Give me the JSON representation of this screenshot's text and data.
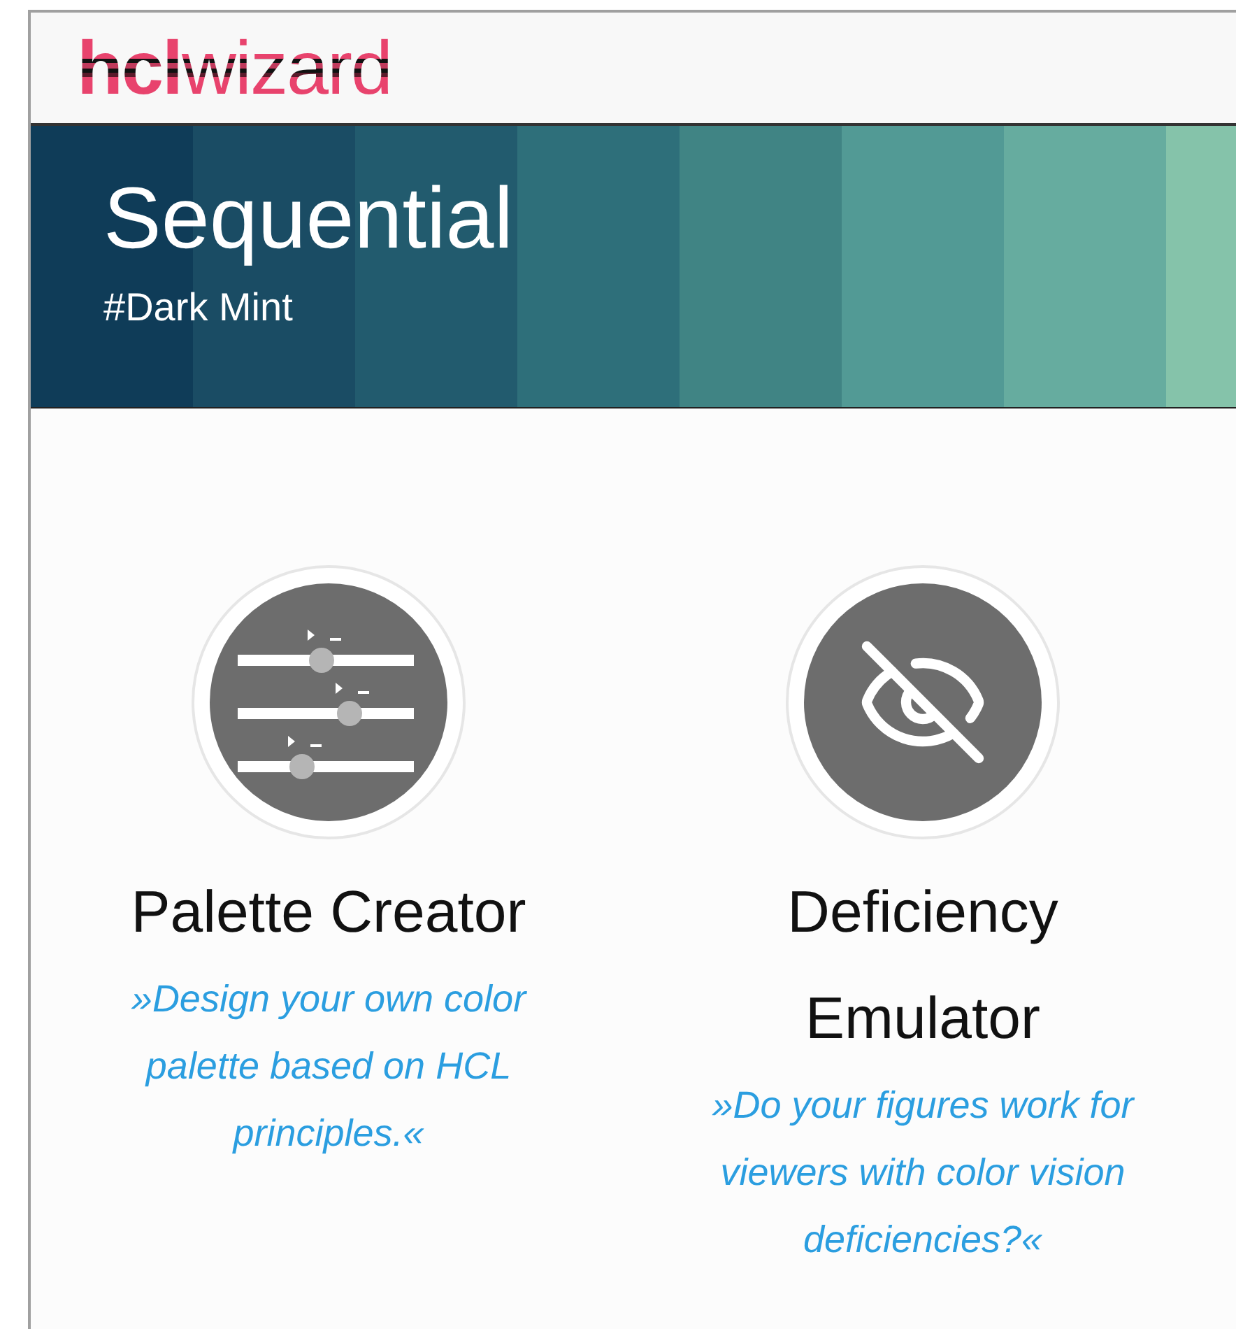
{
  "logo": {
    "bold": "hcl",
    "rest": "wizard"
  },
  "banner": {
    "title": "Sequential",
    "subtitle": "#Dark Mint",
    "swatches": [
      {
        "color": "#0f3c58"
      },
      {
        "color": "#1a4c64"
      },
      {
        "color": "#225b6e"
      },
      {
        "color": "#2e6f7a"
      },
      {
        "color": "#408484"
      },
      {
        "color": "#529a95"
      },
      {
        "color": "#66ac9f"
      },
      {
        "color": "#85c3aa"
      }
    ]
  },
  "cards": [
    {
      "kind": "sliders",
      "title": "Palette Creator",
      "description": "»Design your own color palette based on HCL principles.«"
    },
    {
      "kind": "eye-off",
      "title": "Deficiency Emulator",
      "description": "»Do your figures work for viewers with color vision deficiencies?«"
    }
  ]
}
